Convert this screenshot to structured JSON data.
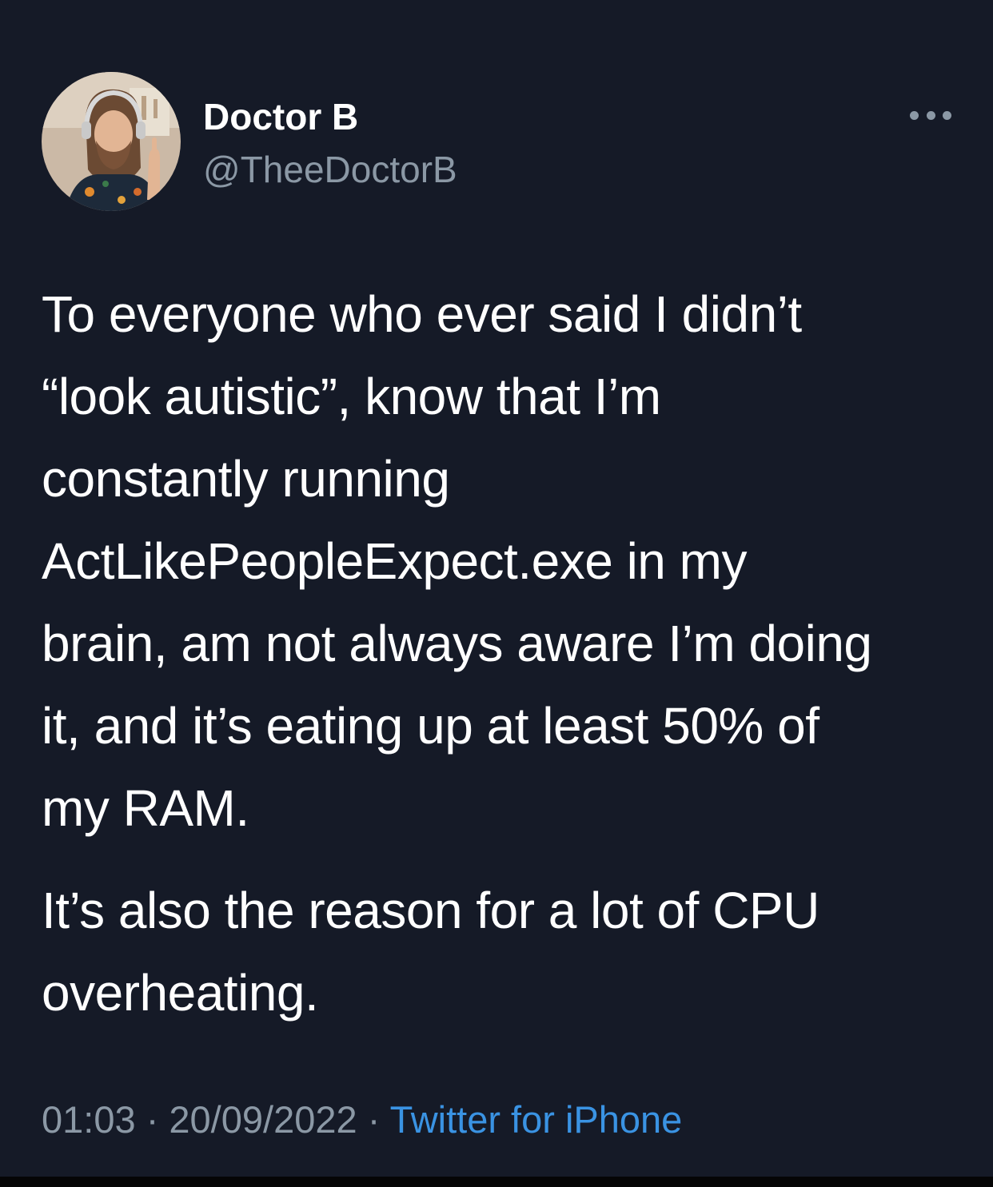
{
  "author": {
    "name": "Doctor B",
    "handle": "@TheeDoctorB"
  },
  "tweet": {
    "paragraphs": [
      {
        "lines": [
          "To everyone who ever said I didn’t",
          "“look autistic”, know that I’m",
          "constantly running",
          "ActLikePeopleExpect.exe in my",
          "brain, am not always aware I’m doing",
          "it, and it’s eating up at least 50% of",
          "my RAM."
        ]
      },
      {
        "lines": [
          "It’s also the reason for a lot of CPU",
          "overheating."
        ]
      }
    ]
  },
  "meta": {
    "time": "01:03",
    "separator": "·",
    "date": "20/09/2022",
    "source": "Twitter for iPhone"
  },
  "icons": {
    "more": "more-horizontal-icon",
    "avatar": "profile-photo"
  },
  "colors": {
    "background": "#151a27",
    "text": "#ffffff",
    "secondary_text": "#8b98a5",
    "link": "#3a93e3"
  }
}
